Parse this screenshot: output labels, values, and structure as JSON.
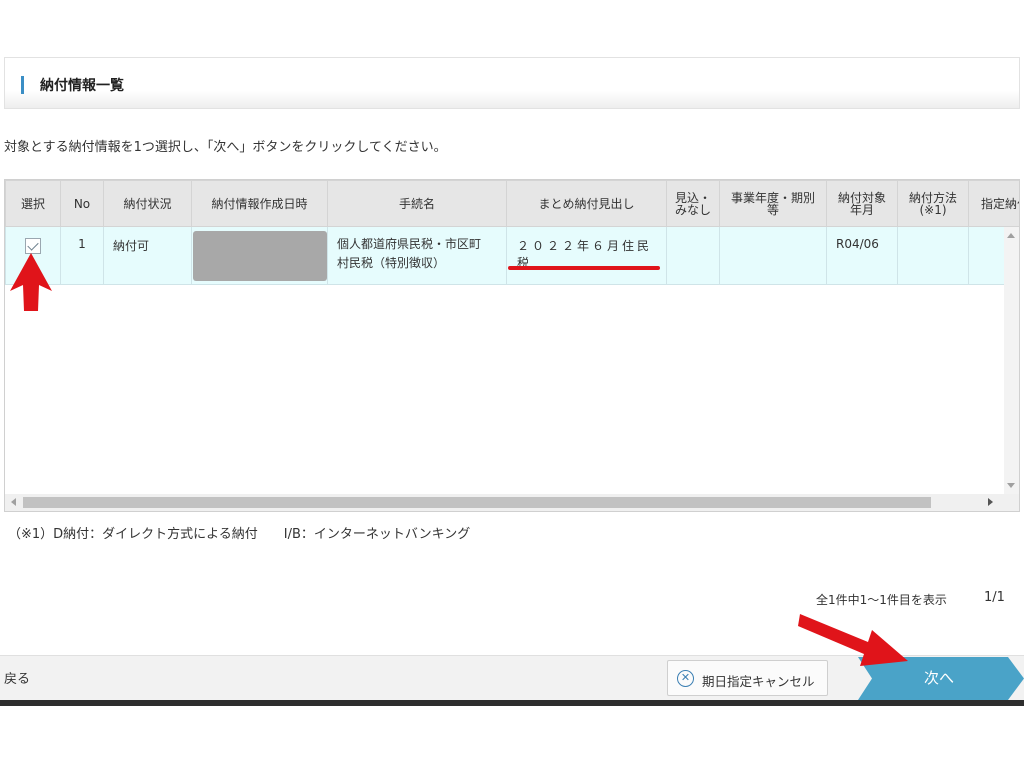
{
  "section": {
    "title": "納付情報一覧"
  },
  "instruction": "対象とする納付情報を1つ選択し、「次へ」ボタンをクリックしてください。",
  "table": {
    "headers": {
      "select": "選択",
      "no": "No",
      "status": "納付状況",
      "created": "納付情報作成日時",
      "procedure": "手続名",
      "heading": "まとめ納付見出し",
      "mikomi_1": "見込・",
      "mikomi_2": "みなし",
      "period_1": "事業年度・期別",
      "period_2": "等",
      "target_1": "納付対象",
      "target_2": "年月",
      "method_1": "納付方法",
      "method_2": "(※1)",
      "designated": "指定納付"
    },
    "rows": [
      {
        "selected": true,
        "no": "1",
        "status": "納付可",
        "created": "",
        "procedure_1": "個人都道府県民税・市区町",
        "procedure_2": "村民税（特別徴収）",
        "heading": "２０２２年６月住民税",
        "mikomi": "",
        "period": "",
        "target": "R04/06",
        "method": "",
        "designated": ""
      }
    ]
  },
  "footnote": {
    "note1": "（※1）D納付：ダイレクト方式による納付",
    "note2": "I/B：インターネットバンキング"
  },
  "pager": {
    "info": "全1件中1～1件目を表示",
    "page": "1/1"
  },
  "footer": {
    "back_label": "戻る",
    "cancel_label": "期日指定キャンセル",
    "next_label": "次へ"
  },
  "colors": {
    "accent_blue": "#4aa3c8",
    "annotation_red": "#e0141a",
    "selected_row": "#e6fcfd"
  },
  "icons": {
    "cancel": "close-circle-icon",
    "annotation": "red-arrow-annotation"
  }
}
